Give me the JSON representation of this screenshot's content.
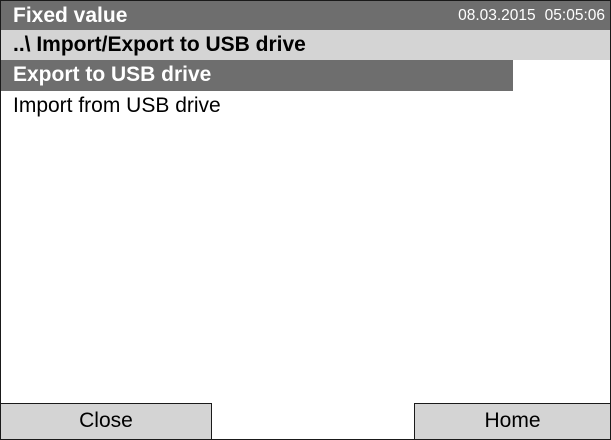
{
  "header": {
    "title": "Fixed value",
    "date": "08.03.2015",
    "time": "05:05:06"
  },
  "breadcrumb": {
    "path": "..\\ Import/Export to USB drive"
  },
  "menu": {
    "items": [
      {
        "label": "Export to USB drive",
        "selected": true
      },
      {
        "label": "Import from USB drive",
        "selected": false
      }
    ]
  },
  "footer": {
    "close_label": "Close",
    "home_label": "Home"
  },
  "colors": {
    "title_bar": "#6e6e6e",
    "breadcrumb_bar": "#d4d4d4",
    "selected_item": "#6e6e6e",
    "button_bg": "#d4d4d4"
  }
}
